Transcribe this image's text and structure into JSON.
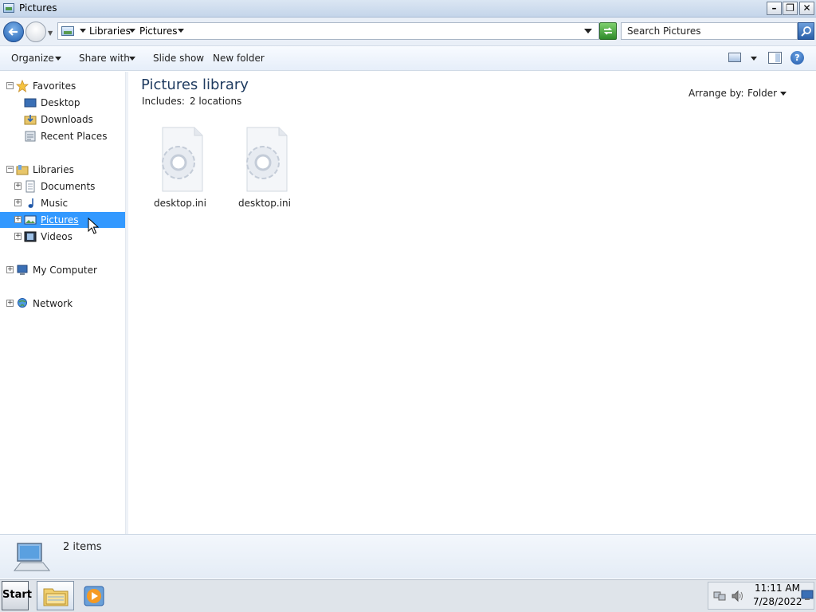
{
  "window": {
    "title": "Pictures"
  },
  "address": {
    "crumbs": [
      "Libraries",
      "Pictures"
    ]
  },
  "search": {
    "placeholder": "Search Pictures"
  },
  "commands": {
    "organize": "Organize",
    "share_with": "Share with",
    "slide_show": "Slide show",
    "new_folder": "New folder"
  },
  "nav": {
    "favorites": {
      "label": "Favorites",
      "items": [
        "Desktop",
        "Downloads",
        "Recent Places"
      ]
    },
    "libraries": {
      "label": "Libraries",
      "items": [
        "Documents",
        "Music",
        "Pictures",
        "Videos"
      ],
      "selected": "Pictures"
    },
    "computer": "My Computer",
    "network": "Network"
  },
  "library": {
    "title": "Pictures library",
    "includes_label": "Includes:",
    "includes_value": "2 locations",
    "arrange_label": "Arrange by:",
    "arrange_value": "Folder"
  },
  "files": [
    {
      "name": "desktop.ini"
    },
    {
      "name": "desktop.ini"
    }
  ],
  "details": {
    "count": "2 items"
  },
  "taskbar": {
    "start": "Start",
    "time": "11:11 AM",
    "date": "7/28/2022"
  },
  "colors": {
    "selection": "#3399ff",
    "title_text": "#1e3a5f"
  }
}
